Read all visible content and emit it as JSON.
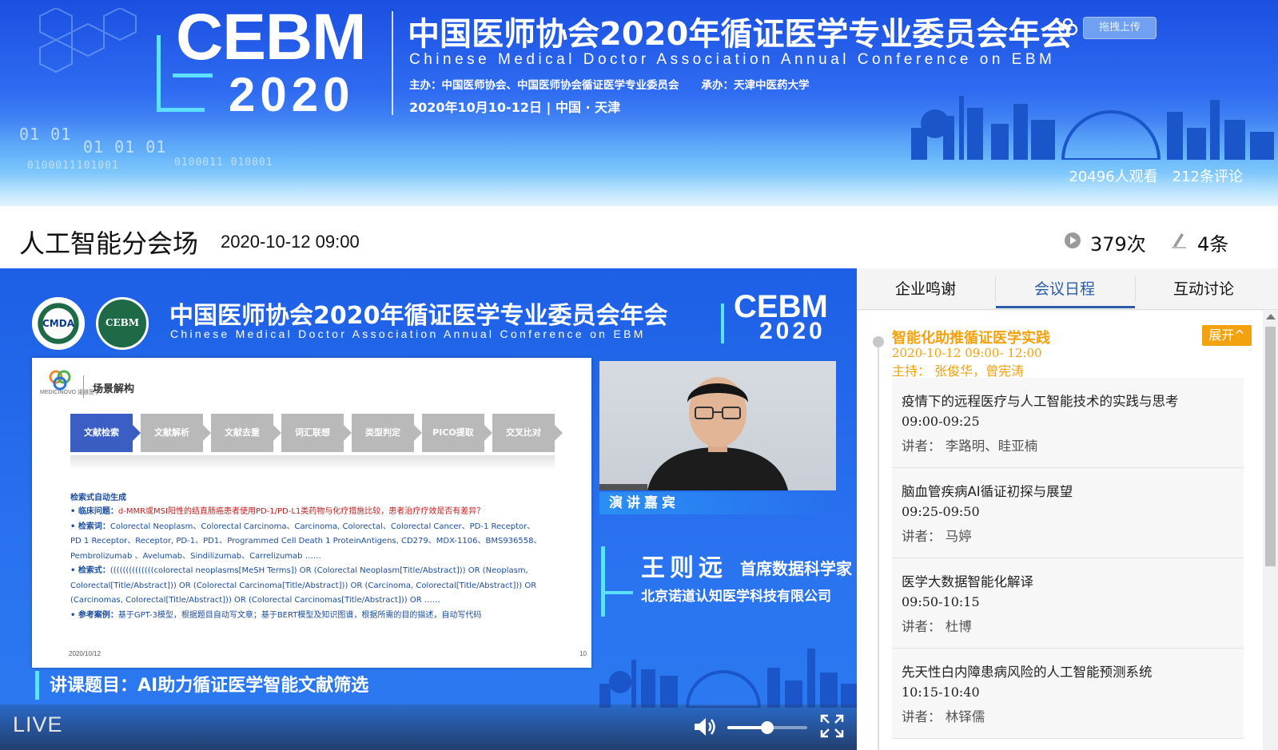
{
  "banner": {
    "logo_word": "CEBM",
    "logo_year": "2020",
    "title": "中国医师协会2020年循证医学专业委员会年会",
    "subtitle": "Chinese Medical Doctor Association Annual  Conference on EBM",
    "host": "主办：中国医师协会、中国医师协会循证医学专业委员会",
    "organizer": "承办：天津中医药大学",
    "date": "2020年10月10-12日 | 中国 · 天津",
    "binary_1": "01 01",
    "binary_2": "01 01 01",
    "binary_3": "0100011101001",
    "binary_4": "0100011  010001",
    "upload_label": "拖拽上传",
    "viewers": "20496人观看",
    "comments": "212条评论"
  },
  "infobar": {
    "title": "人工智能分会场",
    "datetime": "2020-10-12  09:00",
    "views": "379次",
    "comment_count": "4条"
  },
  "video": {
    "logo1": "CMDA",
    "logo2": "CEBM",
    "title": "中国医师协会2020年循证医学专业委员会年会",
    "subtitle": "Chinese Medical Doctor Association Annual  Conference on EBM",
    "cebm_word": "CEBM",
    "cebm_year": "2020",
    "slide": {
      "logo_text": "MEDICINOVO 诺道医学",
      "heading": "场景解构",
      "steps": [
        "文献检索",
        "文献解析",
        "文献去重",
        "词汇联想",
        "类型判定",
        "PICO提取",
        "交叉比对"
      ],
      "section": "检索式自动生成",
      "lines": [
        {
          "prefix": "•  临床问题：",
          "text": "d-MMR或MSI阳性的结直肠癌患者使用PD-1/PD-L1类药物与化疗措施比较，患者治疗疗效是否有差异？"
        },
        {
          "prefix": "•  检索词：",
          "text": "Colorectal Neoplasm、Colorectal Carcinoma、Carcinoma, Colorectal、Colorectal Cancer、PD-1 Receptor、"
        },
        {
          "prefix": "",
          "text": "     PD 1 Receptor、Receptor, PD-1、PD1、Programmed Cell Death 1 ProteinAntigens, CD279、MDX-1106、BMS936558、"
        },
        {
          "prefix": "",
          "text": "     Pembrolizumab 、Avelumab、Sindilizumab、Carrelizumab ……"
        },
        {
          "prefix": "•  检索式：",
          "text": "((((((((((((((colorectal neoplasms[MeSH Terms]) OR (Colorectal Neoplasm[Title/Abstract])) OR (Neoplasm,"
        },
        {
          "prefix": "",
          "text": "     Colorectal[Title/Abstract])) OR (Colorectal Carcinoma[Title/Abstract])) OR (Carcinoma, Colorectal[Title/Abstract])) OR"
        },
        {
          "prefix": "",
          "text": "     (Carcinomas, Colorectal[Title/Abstract])) OR (Colorectal Carcinomas[Title/Abstract])) OR ……"
        },
        {
          "prefix": "•  参考案例：",
          "text": "基于GPT-3模型，根据题目自动写文章；基于BERT模型及知识图谱，根据所需的目的描述，自动写代码"
        }
      ],
      "footer_date": "2020/10/12",
      "footer_page": "10"
    },
    "speaker_tag": "演讲嘉宾",
    "speaker_name": "王则远",
    "speaker_title": "首席数据科学家",
    "speaker_org": "北京诺道认知医学科技有限公司",
    "topic": "讲课题目：AI助力循证医学智能文献筛选",
    "live_label": "LIVE",
    "volume_level": 0.5
  },
  "panel": {
    "tabs": [
      "企业鸣谢",
      "会议日程",
      "互动讨论"
    ],
    "active_tab": 1,
    "session": {
      "title": "智能化助推循证医学实践",
      "time": "2020-10-12 09:00- 12:00",
      "hosts": "主持：  张俊华，曾宪涛",
      "expand_label": "展开^"
    },
    "talks": [
      {
        "title": "疫情下的远程医疗与人工智能技术的实践与思考",
        "time": "09:00-09:25",
        "speaker": "讲者：  李路明、眭亚楠"
      },
      {
        "title": "脑血管疾病AI循证初探与展望",
        "time": "09:25-09:50",
        "speaker": "讲者：  马婷"
      },
      {
        "title": "医学大数据智能化解译",
        "time": "09:50-10:15",
        "speaker": "讲者：  杜博"
      },
      {
        "title": "先天性白内障患病风险的人工智能预测系统",
        "time": "10:15-10:40",
        "speaker": "讲者：  林铎儒"
      }
    ]
  }
}
